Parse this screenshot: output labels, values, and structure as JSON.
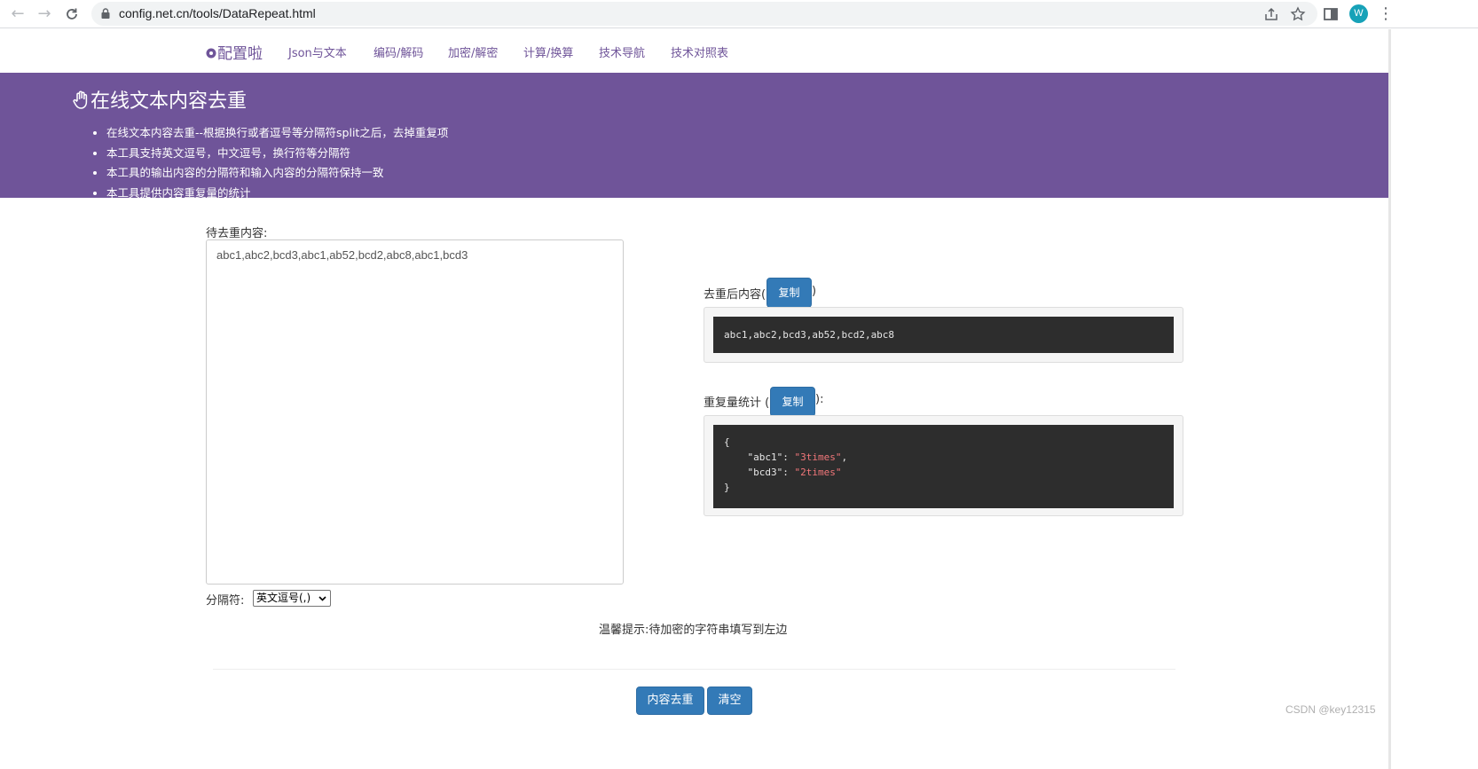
{
  "browser": {
    "url": "config.net.cn/tools/DataRepeat.html",
    "avatar_letter": "W"
  },
  "site": {
    "brand": "配置啦",
    "nav": [
      "Json与文本",
      "编码/解码",
      "加密/解密",
      "计算/换算",
      "技术导航",
      "技术对照表"
    ]
  },
  "banner": {
    "title": "在线文本内容去重",
    "bullets": [
      "在线文本内容去重--根据换行或者逗号等分隔符split之后，去掉重复项",
      "本工具支持英文逗号，中文逗号，换行符等分隔符",
      "本工具的输出内容的分隔符和输入内容的分隔符保持一致",
      "本工具提供内容重复量的统计"
    ]
  },
  "input": {
    "label": "待去重内容:",
    "value": "abc1,abc2,bcd3,abc1,ab52,bcd2,abc8,abc1,bcd3",
    "separator_label": "分隔符:",
    "separator_value": "英文逗号(,)"
  },
  "output": {
    "label_prefix": "去重后内容(",
    "label_suffix": ")",
    "copy_label": "复制",
    "result": "abc1,abc2,bcd3,ab52,bcd2,abc8"
  },
  "stats": {
    "label_prefix": "重复量统计 (",
    "label_suffix": "):",
    "copy_label": "复制",
    "open_brace": "{",
    "close_brace": "}",
    "entries": [
      {
        "key": "\"abc1\"",
        "value": "\"3times\"",
        "comma": ","
      },
      {
        "key": "\"bcd3\"",
        "value": "\"2times\"",
        "comma": ""
      }
    ]
  },
  "hint": "温馨提示:待加密的字符串填写到左边",
  "actions": {
    "dedupe_label": "内容去重",
    "clear_label": "清空"
  },
  "watermark": "CSDN @key12315",
  "colors": {
    "brand_purple": "#6f5499",
    "button_blue": "#337ab7",
    "code_bg": "#2d2d2d",
    "code_string": "#f2777a"
  }
}
